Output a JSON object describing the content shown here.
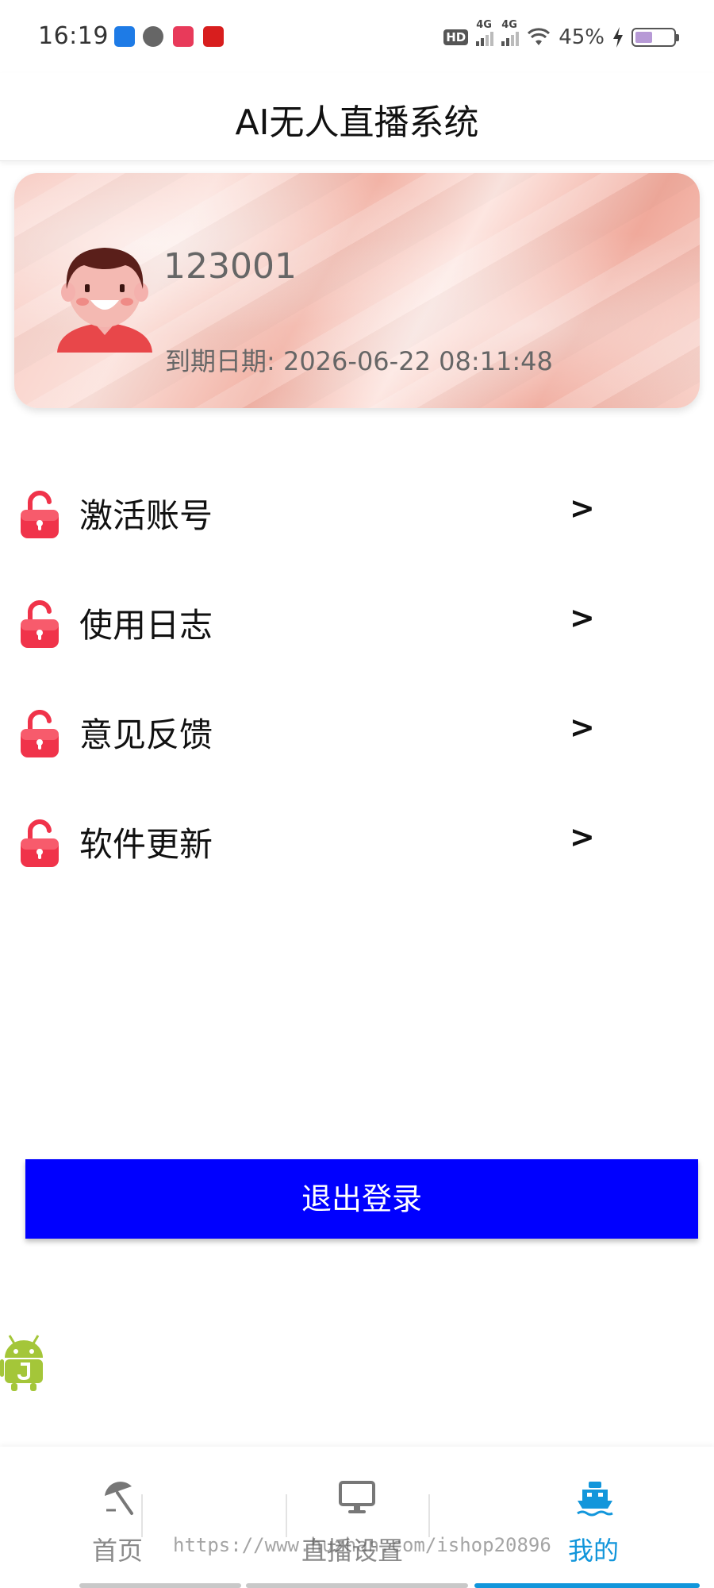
{
  "status_bar": {
    "time": "16:19",
    "network_1": "4G",
    "network_2": "4G",
    "hd": "HD",
    "battery_text": "45%",
    "battery_level": 0.45,
    "app_icons": [
      "uc-icon",
      "message-icon",
      "taobao-icon",
      "bank-icon"
    ]
  },
  "header": {
    "title": "AI无人直播系统"
  },
  "profile": {
    "user_id": "123001",
    "expire_text": "到期日期: 2026-06-22 08:11:48"
  },
  "menu": {
    "items": [
      {
        "label": "激活账号",
        "arrow": ">"
      },
      {
        "label": "使用日志",
        "arrow": ">"
      },
      {
        "label": "意见反馈",
        "arrow": ">"
      },
      {
        "label": "软件更新",
        "arrow": ">"
      }
    ]
  },
  "logout": {
    "label": "退出登录"
  },
  "bottom_nav": {
    "tabs": [
      {
        "label": "首页",
        "icon": "umbrella-icon"
      },
      {
        "label": "直播设置",
        "icon": "monitor-icon"
      },
      {
        "label": "我的",
        "icon": "ship-icon",
        "active": true
      }
    ],
    "active_color": "#1296db",
    "watermark": "https://www.huzhan.com/ishop20896"
  },
  "colors": {
    "logout_bg": "#0000ff",
    "lock_red": "#f0334a",
    "active_tab": "#1296db"
  }
}
